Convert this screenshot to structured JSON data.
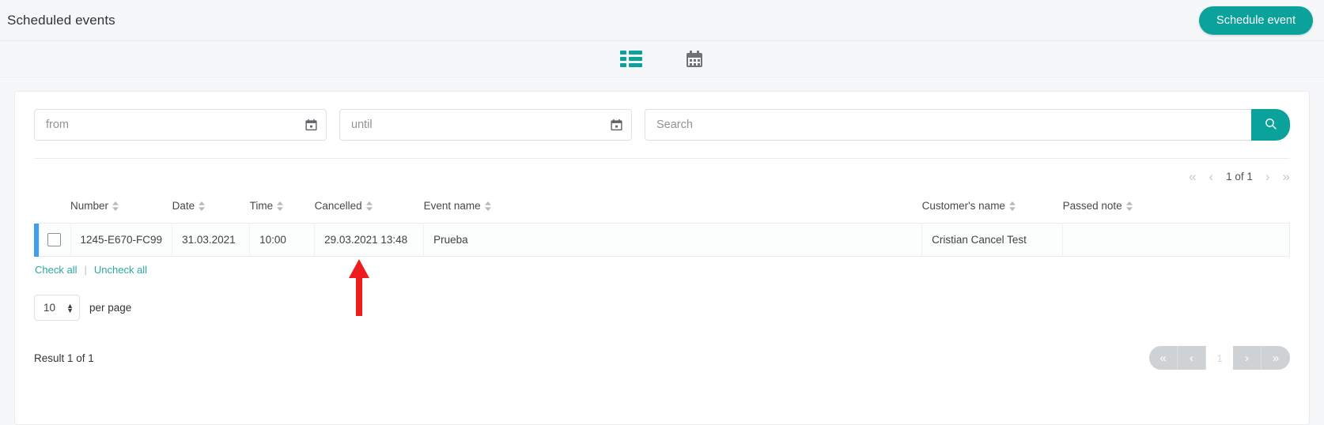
{
  "header": {
    "title": "Scheduled events",
    "schedule_button": "Schedule event"
  },
  "view_toggle": {
    "list_label": "list-view",
    "calendar_label": "calendar-view",
    "active": "list",
    "active_color": "#0aa29a",
    "inactive_color": "#6e7377"
  },
  "filters": {
    "from_placeholder": "from",
    "from_value": "",
    "until_placeholder": "until",
    "until_value": "",
    "search_placeholder": "Search",
    "search_value": "",
    "search_icon": "search-icon",
    "calendar_icon": "calendar-icon"
  },
  "top_pagination": {
    "first": "«",
    "prev": "‹",
    "current": "1 of 1",
    "next": "›",
    "last": "»"
  },
  "table": {
    "columns": [
      "Number",
      "Date",
      "Time",
      "Cancelled",
      "Event name",
      "Customer's name",
      "Passed note"
    ],
    "rows": [
      {
        "selected": false,
        "number": "1245-E670-FC99",
        "date": "31.03.2021",
        "time": "10:00",
        "cancelled": "29.03.2021 13:48",
        "event_name": "Prueba",
        "customer_name": "Cristian Cancel Test",
        "passed_note": "",
        "accent_color": "#3ba1ef"
      }
    ]
  },
  "selection": {
    "check_all": "Check all",
    "separator": "|",
    "uncheck_all": "Uncheck all",
    "link_color": "#2aa8a1"
  },
  "per_page": {
    "value": "10",
    "label": "per page"
  },
  "footer": {
    "result_text": "Result 1 of 1",
    "first": "«",
    "prev": "‹",
    "page_number": "1",
    "next": "›",
    "last": "»"
  },
  "annotation": {
    "arrow_color": "#ee1c1c",
    "points_at": "Cancelled"
  },
  "theme": {
    "primary": "#0aa29a",
    "page_bg": "#f6f7f8",
    "card_bg": "#ffffff",
    "border": "#e9ecef"
  }
}
